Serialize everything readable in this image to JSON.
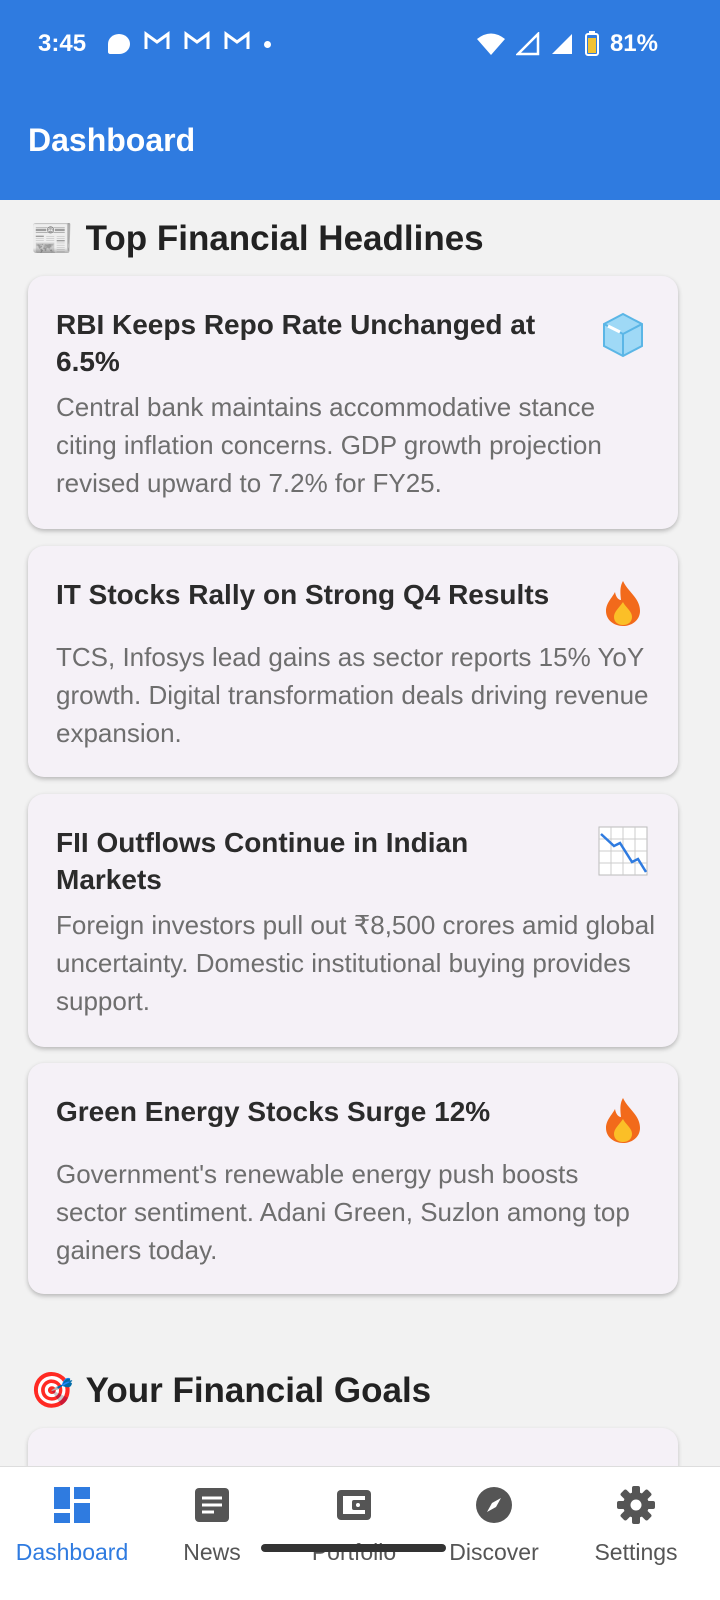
{
  "status_bar": {
    "time": "3:45",
    "battery": "81%",
    "notifications": [
      "chat-icon",
      "gmail-icon",
      "gmail-icon",
      "gmail-icon",
      "dot"
    ]
  },
  "app_bar": {
    "title": "Dashboard"
  },
  "headlines_section": {
    "emoji": "📰",
    "title": "Top Financial Headlines",
    "cards": [
      {
        "title": "RBI Keeps Repo Rate Unchanged at 6.5%",
        "body": "Central bank maintains accommodative stance citing inflation concerns. GDP growth projection revised upward to 7.2% for FY25.",
        "icon": "ice-cube-icon",
        "emoji": "🧊"
      },
      {
        "title": "IT Stocks Rally on Strong Q4 Results",
        "body": "TCS, Infosys lead gains as sector reports 15% YoY growth. Digital transformation deals driving revenue expansion.",
        "icon": "fire-icon",
        "emoji": "🔥"
      },
      {
        "title": "FII Outflows Continue in Indian Markets",
        "body": "Foreign investors pull out ₹8,500 crores amid global uncertainty. Domestic institutional buying provides support.",
        "icon": "chart-decreasing-icon",
        "emoji": "📉"
      },
      {
        "title": "Green Energy Stocks Surge 12%",
        "body": "Government's renewable energy push boosts sector sentiment. Adani Green, Suzlon among top gainers today.",
        "icon": "fire-icon",
        "emoji": "🔥"
      }
    ]
  },
  "goals_section": {
    "emoji": "🎯",
    "title": "Your Financial Goals"
  },
  "bottom_nav": {
    "active_color": "#2f7be0",
    "items": [
      {
        "label": "Dashboard",
        "icon": "dashboard-icon"
      },
      {
        "label": "News",
        "icon": "news-icon"
      },
      {
        "label": "Portfolio",
        "icon": "wallet-icon"
      },
      {
        "label": "Discover",
        "icon": "compass-icon"
      },
      {
        "label": "Settings",
        "icon": "gear-icon"
      }
    ]
  }
}
